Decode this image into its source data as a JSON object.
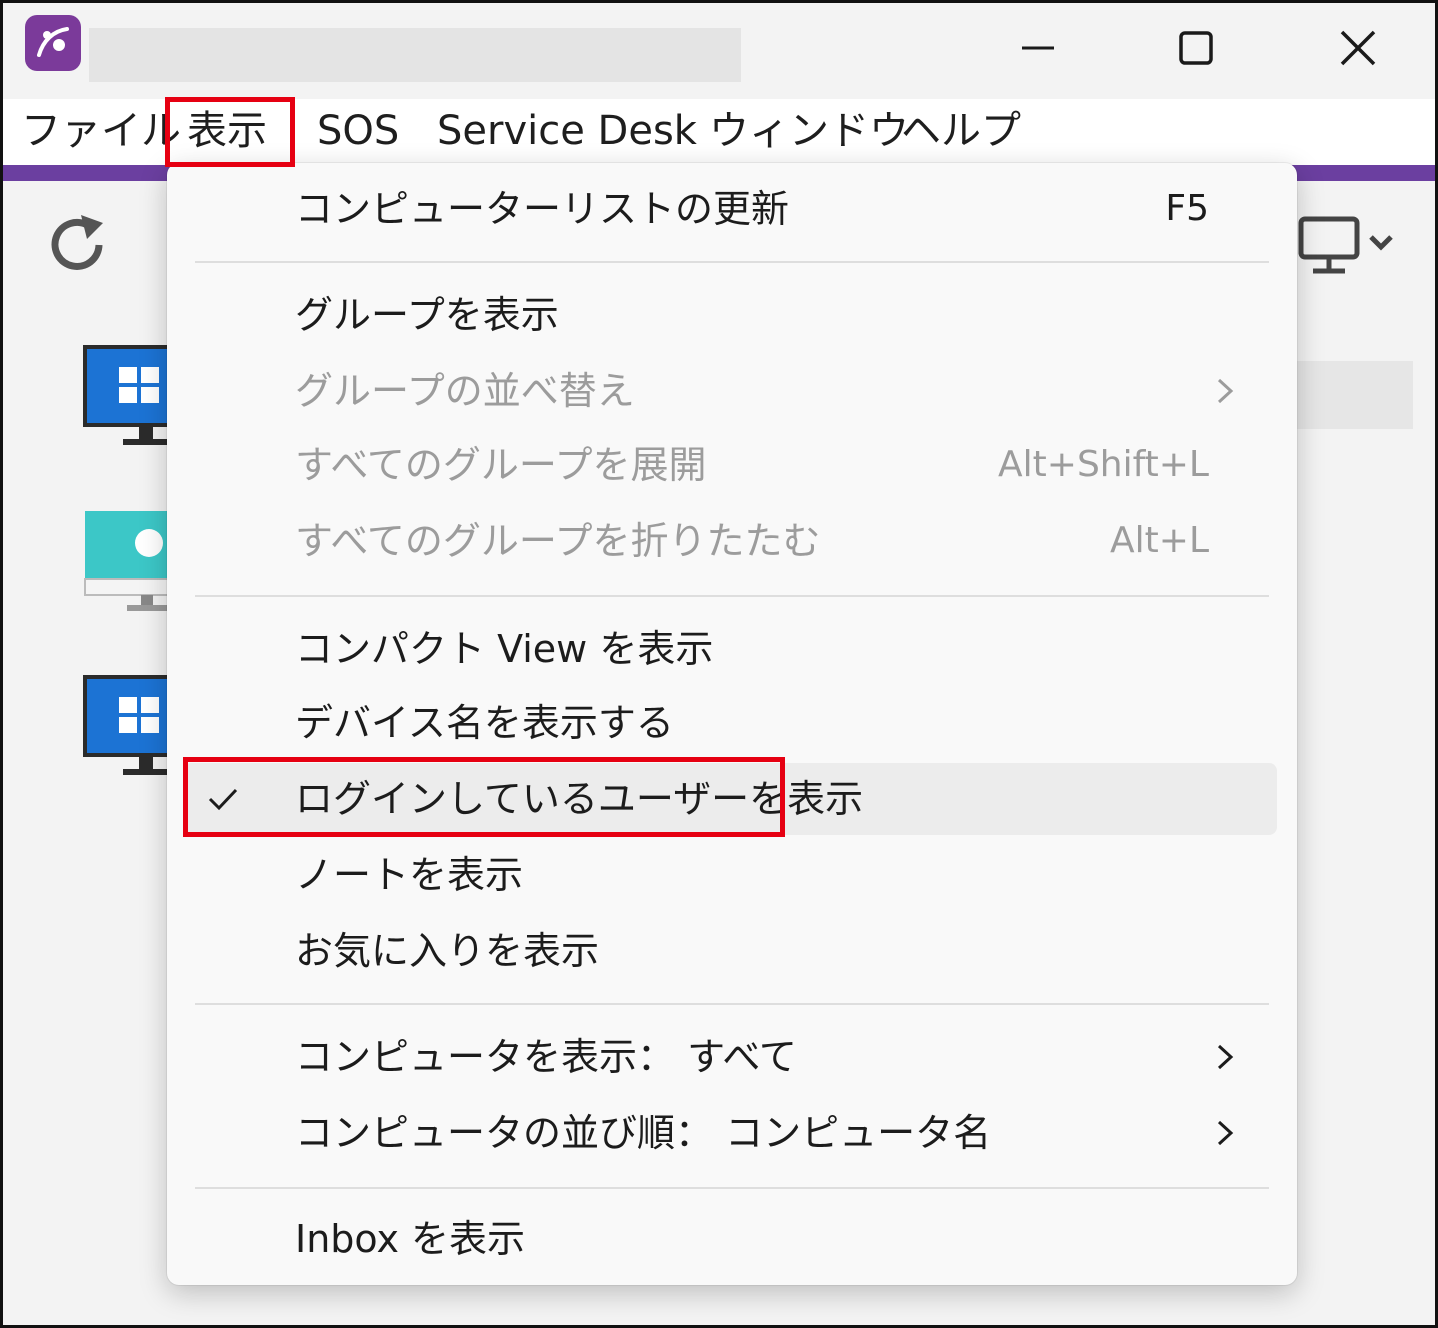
{
  "window": {
    "app_icon": "splashtop-logo-icon",
    "title": "",
    "controls": [
      "minimize-icon",
      "maximize-icon",
      "close-icon"
    ]
  },
  "menubar": {
    "items": [
      {
        "label": "ファイル"
      },
      {
        "label": "表示"
      },
      {
        "label": "SOS"
      },
      {
        "label": "Service Desk"
      },
      {
        "label": "ウィンドウ"
      },
      {
        "label": "ヘルプ"
      }
    ],
    "active": "表示"
  },
  "toolbar": {
    "refresh_icon": "refresh-icon",
    "view_icon": "monitor-icon"
  },
  "device_list": {
    "icons": [
      "windows-monitor-icon",
      "mac-monitor-icon",
      "windows-monitor-icon"
    ]
  },
  "view_menu": {
    "items": [
      {
        "label": "コンピューターリストの更新",
        "shortcut": "F5",
        "enabled": true
      },
      {
        "label": "グループを表示",
        "shortcut": "",
        "enabled": true
      },
      {
        "label": "グループの並べ替え",
        "shortcut": "",
        "enabled": false,
        "submenu": true
      },
      {
        "label": "すべてのグループを展開",
        "shortcut": "Alt+Shift+L",
        "enabled": false
      },
      {
        "label": "すべてのグループを折りたたむ",
        "shortcut": "Alt+L",
        "enabled": false
      },
      {
        "label": "コンパクト View を表示",
        "shortcut": "",
        "enabled": true
      },
      {
        "label": "デバイス名を表示する",
        "shortcut": "",
        "enabled": true
      },
      {
        "label": "ログインしているユーザーを表示",
        "shortcut": "",
        "enabled": true,
        "checked": true,
        "highlighted": true
      },
      {
        "label": "ノートを表示",
        "shortcut": "",
        "enabled": true
      },
      {
        "label": "お気に入りを表示",
        "shortcut": "",
        "enabled": true
      },
      {
        "label": "コンピュータを表示： すべて",
        "shortcut": "",
        "enabled": true,
        "submenu": true
      },
      {
        "label": "コンピュータの並び順： コンピュータ名",
        "shortcut": "",
        "enabled": true,
        "submenu": true
      },
      {
        "label": "Inbox を表示",
        "shortcut": "",
        "enabled": true
      }
    ]
  },
  "colors": {
    "accent": "#6b3fa0",
    "annotation_red": "#e60012",
    "disabled_text": "#9c9c9c"
  }
}
